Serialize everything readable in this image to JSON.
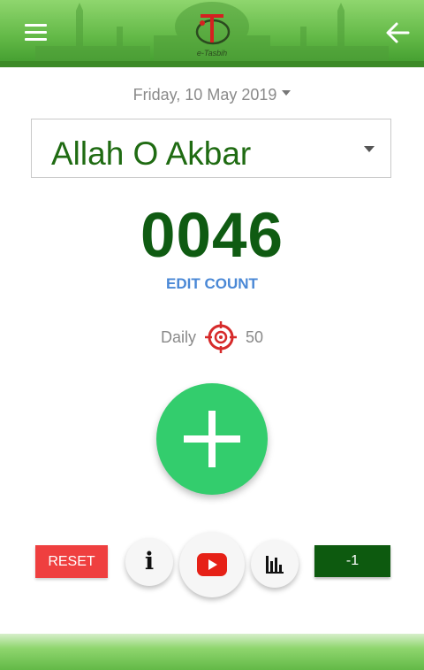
{
  "header": {
    "logo_text": "e-Tasbih",
    "menu_icon": "hamburger-menu-icon",
    "back_icon": "arrow-left-icon",
    "colors": {
      "top": "#8fd66e",
      "bottom": "#3f9a2c"
    }
  },
  "date": {
    "label": "Friday, 10 May 2019"
  },
  "dhikr": {
    "selected": "Allah O Akbar"
  },
  "counter": {
    "value": "0046",
    "edit_label": "EDIT COUNT"
  },
  "daily_target": {
    "label": "Daily",
    "value": "50",
    "icon": "target-icon"
  },
  "increment": {
    "icon": "plus-icon"
  },
  "controls": {
    "reset_label": "RESET",
    "info_label": "i",
    "youtube_icon": "youtube-icon",
    "stats_icon": "bar-chart-icon",
    "minus_label": "-1"
  },
  "colors": {
    "counter": "#0f5b12",
    "dhikr_text": "#1f6b12",
    "edit_link": "#4a88d6",
    "plus_button": "#33cd6d",
    "reset": "#ef3f3f",
    "minus": "#0d5a0f"
  }
}
